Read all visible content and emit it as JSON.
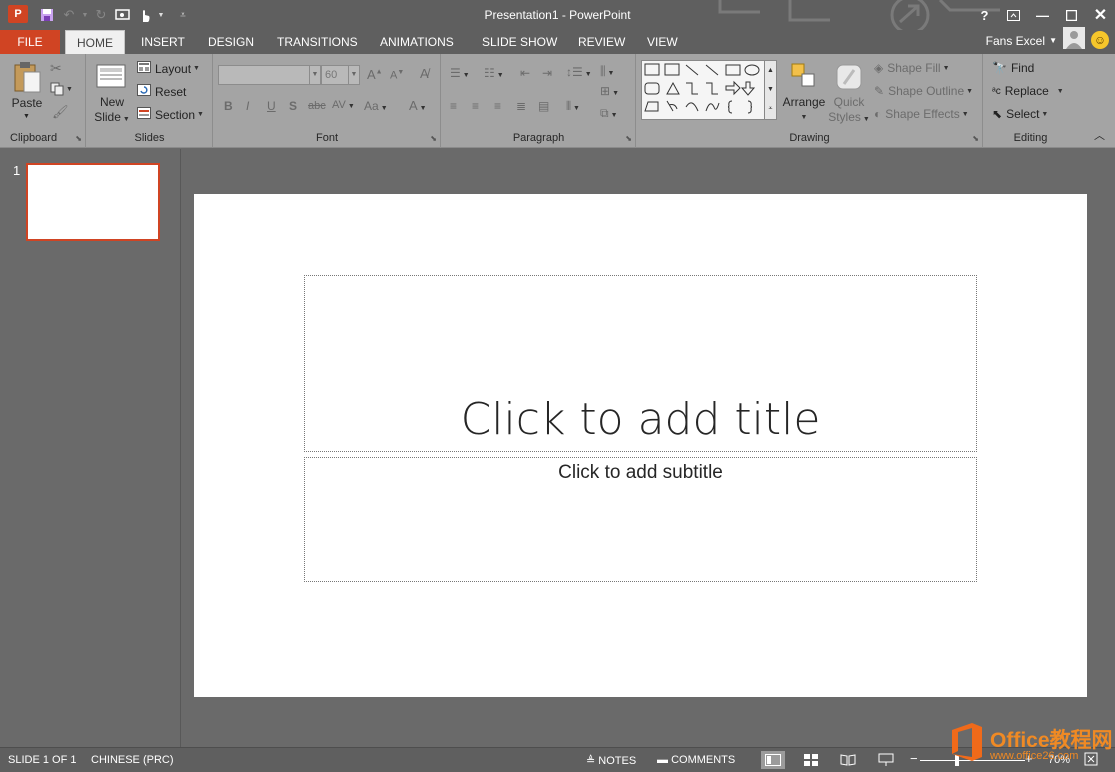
{
  "app": {
    "window_title": "Presentation1 - PowerPoint",
    "logo_letter": "P"
  },
  "tabs": [
    "FILE",
    "HOME",
    "INSERT",
    "DESIGN",
    "TRANSITIONS",
    "ANIMATIONS",
    "SLIDE SHOW",
    "REVIEW",
    "VIEW"
  ],
  "account": {
    "name": "Fans Excel"
  },
  "ribbon": {
    "clipboard": {
      "label": "Clipboard",
      "paste": "Paste"
    },
    "slides": {
      "label": "Slides",
      "new_slide_line1": "New",
      "new_slide_line2": "Slide",
      "layout": "Layout",
      "reset": "Reset",
      "section": "Section"
    },
    "font": {
      "label": "Font",
      "font_size": "60"
    },
    "paragraph": {
      "label": "Paragraph"
    },
    "drawing": {
      "label": "Drawing",
      "arrange": "Arrange",
      "quick_styles_line1": "Quick",
      "quick_styles_line2": "Styles",
      "shape_fill": "Shape Fill",
      "shape_outline": "Shape Outline",
      "shape_effects": "Shape Effects"
    },
    "editing": {
      "label": "Editing",
      "find": "Find",
      "replace": "Replace",
      "select": "Select"
    }
  },
  "thumbnails": {
    "slide_number": "1"
  },
  "slide": {
    "title_placeholder": "Click to add title",
    "subtitle_placeholder": "Click to add subtitle"
  },
  "statusbar": {
    "slide_info": "SLIDE 1 OF 1",
    "language": "CHINESE (PRC)",
    "notes": "NOTES",
    "comments": "COMMENTS",
    "zoom": "70%"
  },
  "watermark": {
    "brand": "Office教程网",
    "url": "www.office26.com"
  },
  "colors": {
    "accent": "#d04423",
    "ribbon_bg": "#a4a4a4",
    "chrome_bg": "#5f5f5f",
    "watermark": "#f08a24"
  }
}
